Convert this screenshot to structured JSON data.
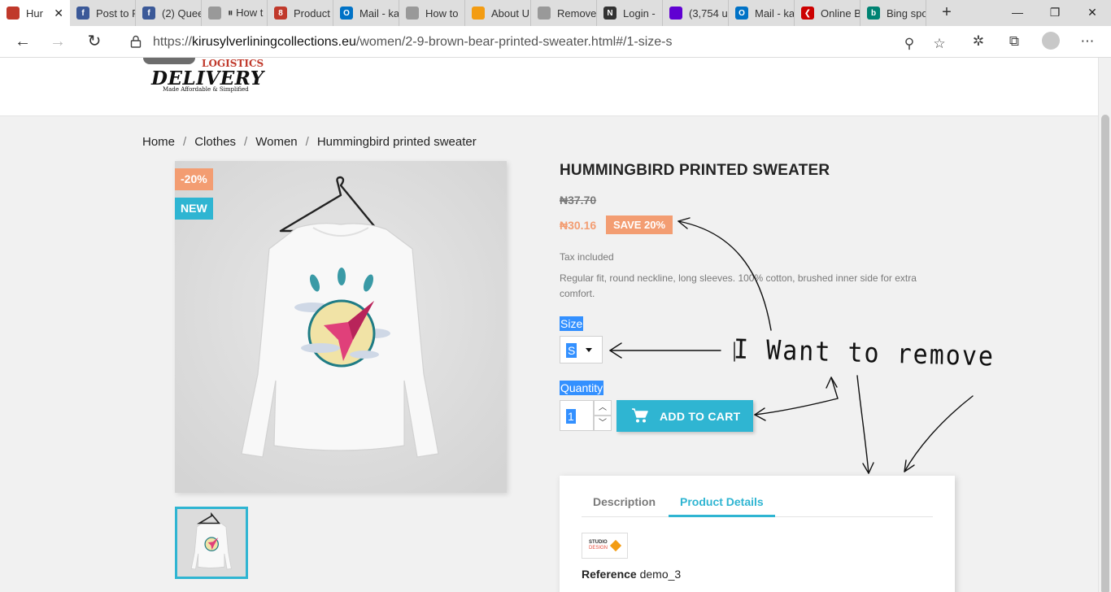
{
  "browser": {
    "tabs": [
      {
        "title": "Hur",
        "color": "#c0392b",
        "glyph": "",
        "active": true
      },
      {
        "title": "Post to F",
        "color": "#3b5998",
        "glyph": "f"
      },
      {
        "title": "(2) Quee",
        "color": "#3b5998",
        "glyph": "f"
      },
      {
        "title": "⏸ How t",
        "color": "#999999",
        "glyph": ""
      },
      {
        "title": "Product",
        "color": "#c0392b",
        "glyph": "8"
      },
      {
        "title": "Mail - ka",
        "color": "#0072c6",
        "glyph": "O"
      },
      {
        "title": "How to",
        "color": "#999999",
        "glyph": ""
      },
      {
        "title": "About U",
        "color": "#f39c12",
        "glyph": ""
      },
      {
        "title": "Remove",
        "color": "#999999",
        "glyph": ""
      },
      {
        "title": "Login - ",
        "color": "#333333",
        "glyph": "N"
      },
      {
        "title": "(3,754 u",
        "color": "#6001d2",
        "glyph": ""
      },
      {
        "title": "Mail - ka",
        "color": "#0072c6",
        "glyph": "O"
      },
      {
        "title": "Online B",
        "color": "#cc0000",
        "glyph": "❮"
      },
      {
        "title": "Bing spo",
        "color": "#008373",
        "glyph": "b"
      }
    ],
    "url_prefix": "https://",
    "url_host": "kirusylverliningcollections.eu",
    "url_path": "/women/2-9-brown-bear-printed-sweater.html#/1-size-s"
  },
  "header": {
    "logo_line1": "LOGISTICS",
    "logo_line2": "DELIVERY",
    "logo_line3": "Made Affordable & Simplified"
  },
  "breadcrumb": [
    "Home",
    "Clothes",
    "Women",
    "Hummingbird printed sweater"
  ],
  "product": {
    "flag_discount": "-20%",
    "flag_new": "NEW",
    "title": "HUMMINGBIRD PRINTED SWEATER",
    "old_price": "₦37.70",
    "price": "₦30.16",
    "save_badge": "SAVE 20%",
    "tax": "Tax included",
    "description": "Regular fit, round neckline, long sleeves. 100% cotton, brushed inner side for extra comfort.",
    "size_label": "Size",
    "size_value": "S",
    "quantity_label": "Quantity",
    "quantity_value": "1",
    "add_to_cart": "ADD TO CART"
  },
  "details": {
    "tab_description": "Description",
    "tab_product_details": "Product Details",
    "brand_logo_line1": "STUDIO",
    "brand_logo_line2": "DESIGN",
    "reference_label": "Reference",
    "reference_value": "demo_3"
  },
  "annotation": {
    "text": "I Want to remove"
  }
}
